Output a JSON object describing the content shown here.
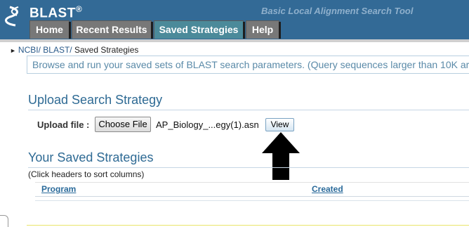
{
  "header": {
    "logo": "BLAST",
    "logo_mark": "®",
    "tagline": "Basic Local Alignment Search Tool",
    "tabs": [
      {
        "label": "Home",
        "active": false
      },
      {
        "label": "Recent Results",
        "active": false
      },
      {
        "label": "Saved Strategies",
        "active": true
      },
      {
        "label": "Help",
        "active": false
      }
    ]
  },
  "breadcrumb": {
    "ncbi": "NCBI/",
    "blast": "BLAST/",
    "current": "Saved Strategies"
  },
  "info": {
    "text": "Browse and run your saved sets of BLAST search parameters. (Query sequences larger than 10K ar"
  },
  "upload": {
    "title": "Upload Search Strategy",
    "label": "Upload file :",
    "choose_button": "Choose File",
    "file_name": "AP_Biology_...egy(1).asn",
    "view_button": "View"
  },
  "saved": {
    "title": "Your Saved Strategies",
    "hint": "(Click headers to sort columns)",
    "columns": [
      "Program",
      "Created"
    ]
  },
  "colors": {
    "header_bg": "#336a96",
    "tab_bg": "#787878",
    "tab_active_bg": "#4b8a9a",
    "heading": "#2e6a94",
    "info_text": "#5a8aa8"
  }
}
